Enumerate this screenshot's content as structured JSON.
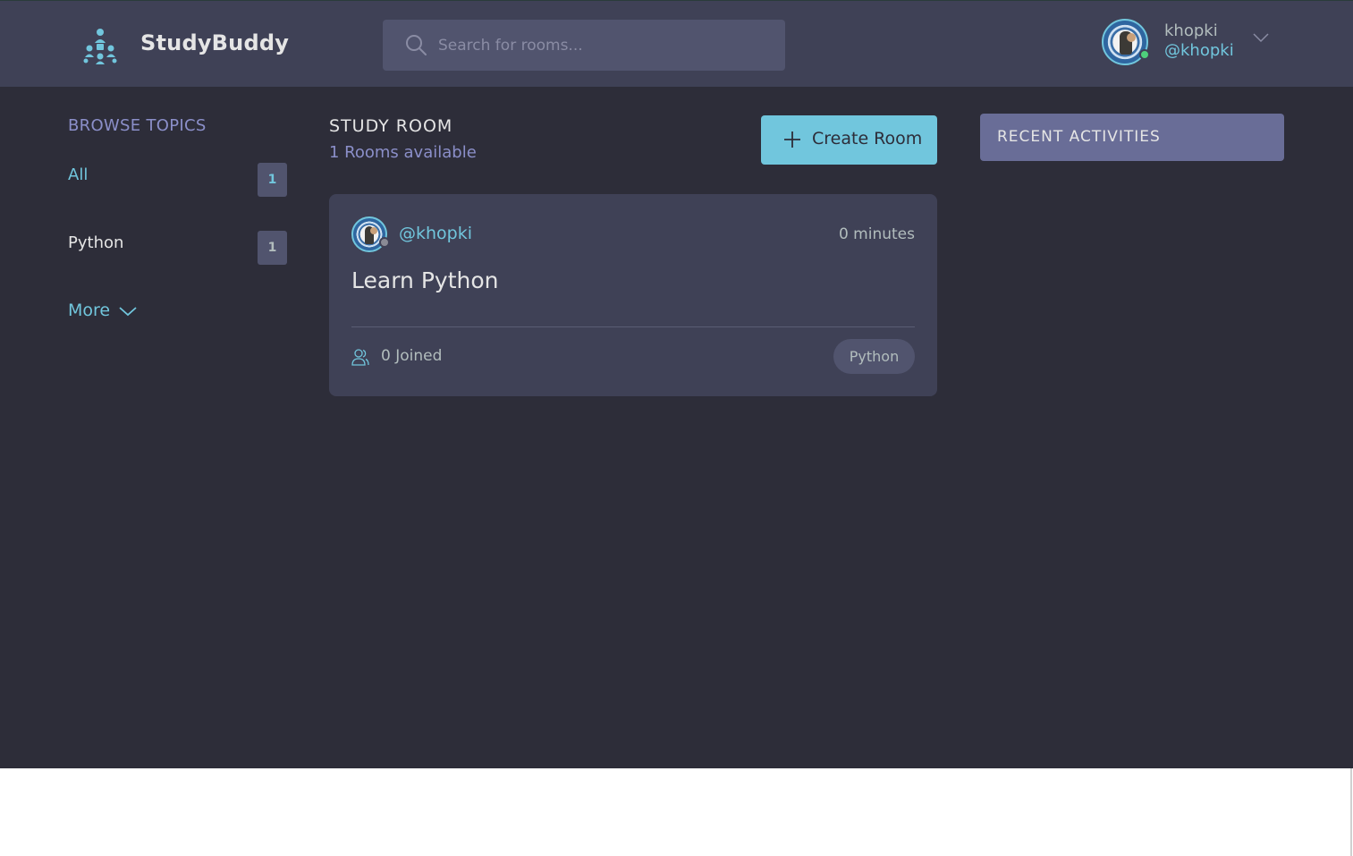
{
  "header": {
    "brand": "StudyBuddy",
    "search_placeholder": "Search for rooms...",
    "user": {
      "name": "khopki",
      "handle": "@khopki",
      "status": "online"
    }
  },
  "sidebar": {
    "title": "BROWSE TOPICS",
    "topics": [
      {
        "label": "All",
        "count": "1",
        "active": true
      },
      {
        "label": "Python",
        "count": "1",
        "active": false
      }
    ],
    "more_label": "More"
  },
  "main": {
    "title": "STUDY ROOM",
    "subtitle": "1 Rooms available",
    "create_label": "Create Room",
    "rooms": [
      {
        "host": "@khopki",
        "time": "0 minutes",
        "title": "Learn Python",
        "joined": "0 Joined",
        "topic": "Python"
      }
    ]
  },
  "activity": {
    "title": "RECENT ACTIVITIES"
  },
  "colors": {
    "background": "#2d2d39",
    "header": "#3f4156",
    "accent": "#71c6dd",
    "muted_purple": "#8b8fc9",
    "activity_header": "#696d97"
  }
}
